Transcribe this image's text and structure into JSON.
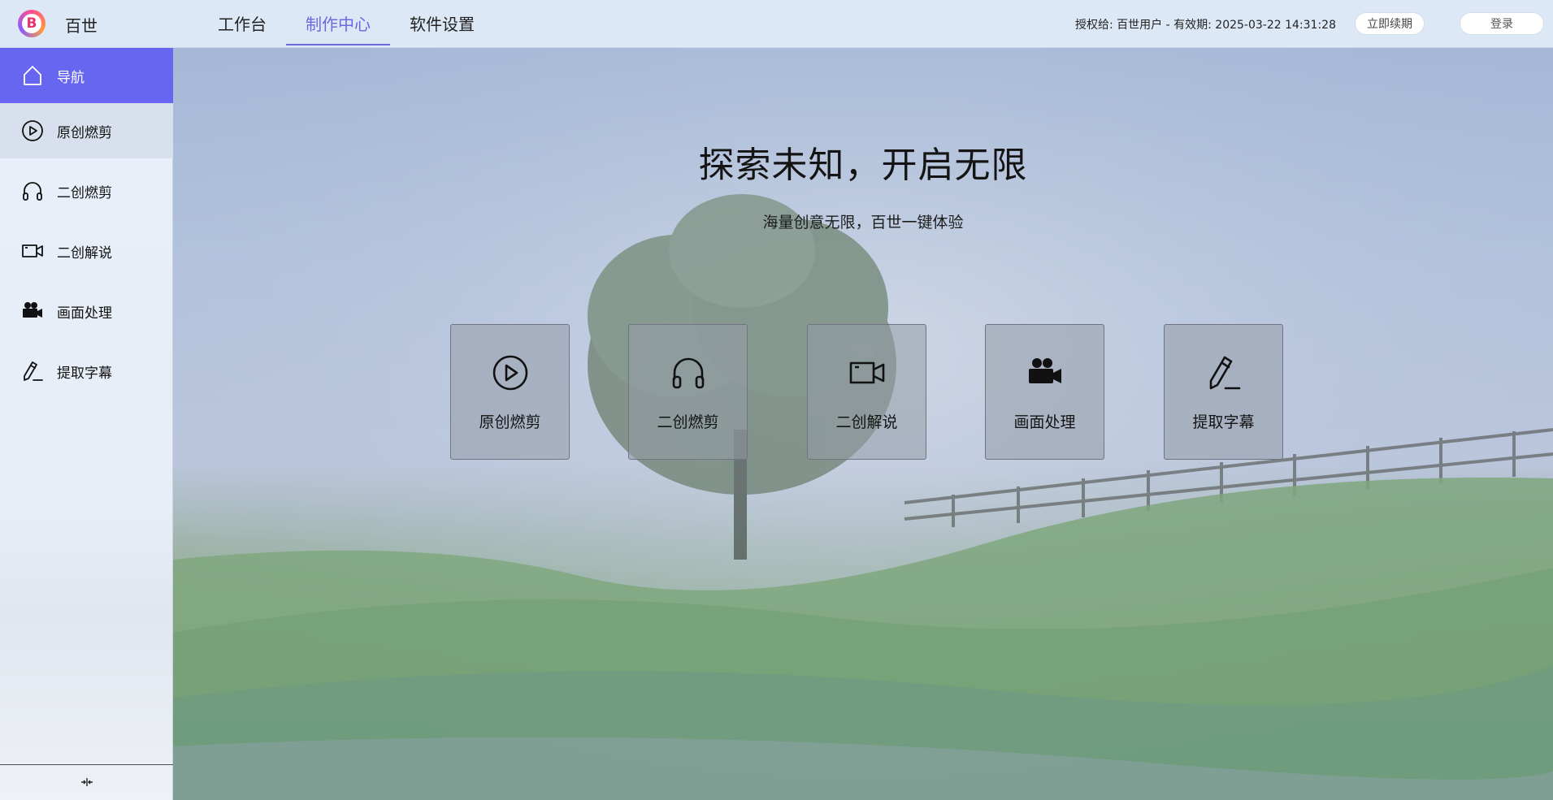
{
  "app": {
    "name": "百世",
    "logo_letter": "B"
  },
  "topnav": {
    "items": [
      {
        "label": "工作台",
        "active": false
      },
      {
        "label": "制作中心",
        "active": true
      },
      {
        "label": "软件设置",
        "active": false
      }
    ]
  },
  "license": {
    "text": "授权给:  百世用户 - 有效期:  2025-03-22 14:31:28",
    "renew_label": "立即续期",
    "login_label": "登录"
  },
  "sidebar": {
    "items": [
      {
        "label": "导航",
        "icon": "home-icon",
        "active": true
      },
      {
        "label": "原创燃剪",
        "icon": "play-circle-icon",
        "active": false
      },
      {
        "label": "二创燃剪",
        "icon": "headphones-icon",
        "active": false
      },
      {
        "label": "二创解说",
        "icon": "video-camera-icon",
        "active": false
      },
      {
        "label": "画面处理",
        "icon": "movie-camera-icon",
        "active": false
      },
      {
        "label": "提取字幕",
        "icon": "pen-icon",
        "active": false
      }
    ],
    "collapse_icon": "collapse-icon"
  },
  "hero": {
    "title": "探索未知，开启无限",
    "subtitle": "海量创意无限，百世一键体验"
  },
  "cards": [
    {
      "label": "原创燃剪",
      "icon": "play-circle-icon"
    },
    {
      "label": "二创燃剪",
      "icon": "headphones-icon"
    },
    {
      "label": "二创解说",
      "icon": "video-camera-icon"
    },
    {
      "label": "画面处理",
      "icon": "movie-camera-icon"
    },
    {
      "label": "提取字幕",
      "icon": "pen-icon"
    }
  ],
  "colors": {
    "accent": "#6766f0",
    "active_nav": "#6b68e0",
    "topbar_bg": "#dde8f7"
  }
}
